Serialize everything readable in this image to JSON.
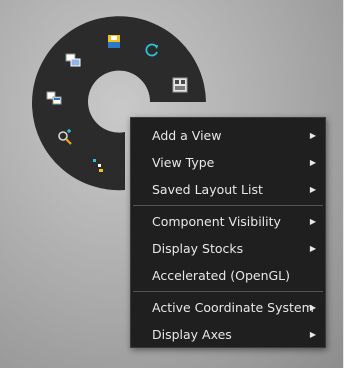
{
  "menu": {
    "group1": [
      {
        "label": "Add a View",
        "submenu_icon": "chevron-right-icon"
      },
      {
        "label": "View Type",
        "submenu_icon": "chevron-right-icon"
      },
      {
        "label": "Saved Layout List",
        "submenu_icon": "chevron-right-icon"
      }
    ],
    "group2": [
      {
        "label": "Component Visibility",
        "submenu_icon": "chevron-right-icon"
      },
      {
        "label": "Display Stocks",
        "submenu_icon": "chevron-right-icon"
      },
      {
        "label": "Accelerated (OpenGL)"
      }
    ],
    "group3": [
      {
        "label": "Active Coordinate System",
        "submenu_icon": "chevron-right-icon"
      },
      {
        "label": "Display Axes",
        "submenu_icon": "chevron-right-icon"
      }
    ],
    "arrow_glyph": "▶"
  },
  "radial_menu": {
    "icons": [
      "save-view-icon",
      "refresh-icon",
      "layout-icon",
      "copy-view-icon",
      "views-icon",
      "zoom-icon",
      "axes-icon"
    ]
  },
  "colors": {
    "menu_bg": "#1f1f1f",
    "menu_text": "#e8e8e8",
    "ring_bg": "#2b2b2b",
    "accent_cyan": "#29c2d8",
    "accent_yellow": "#f2c21b"
  }
}
